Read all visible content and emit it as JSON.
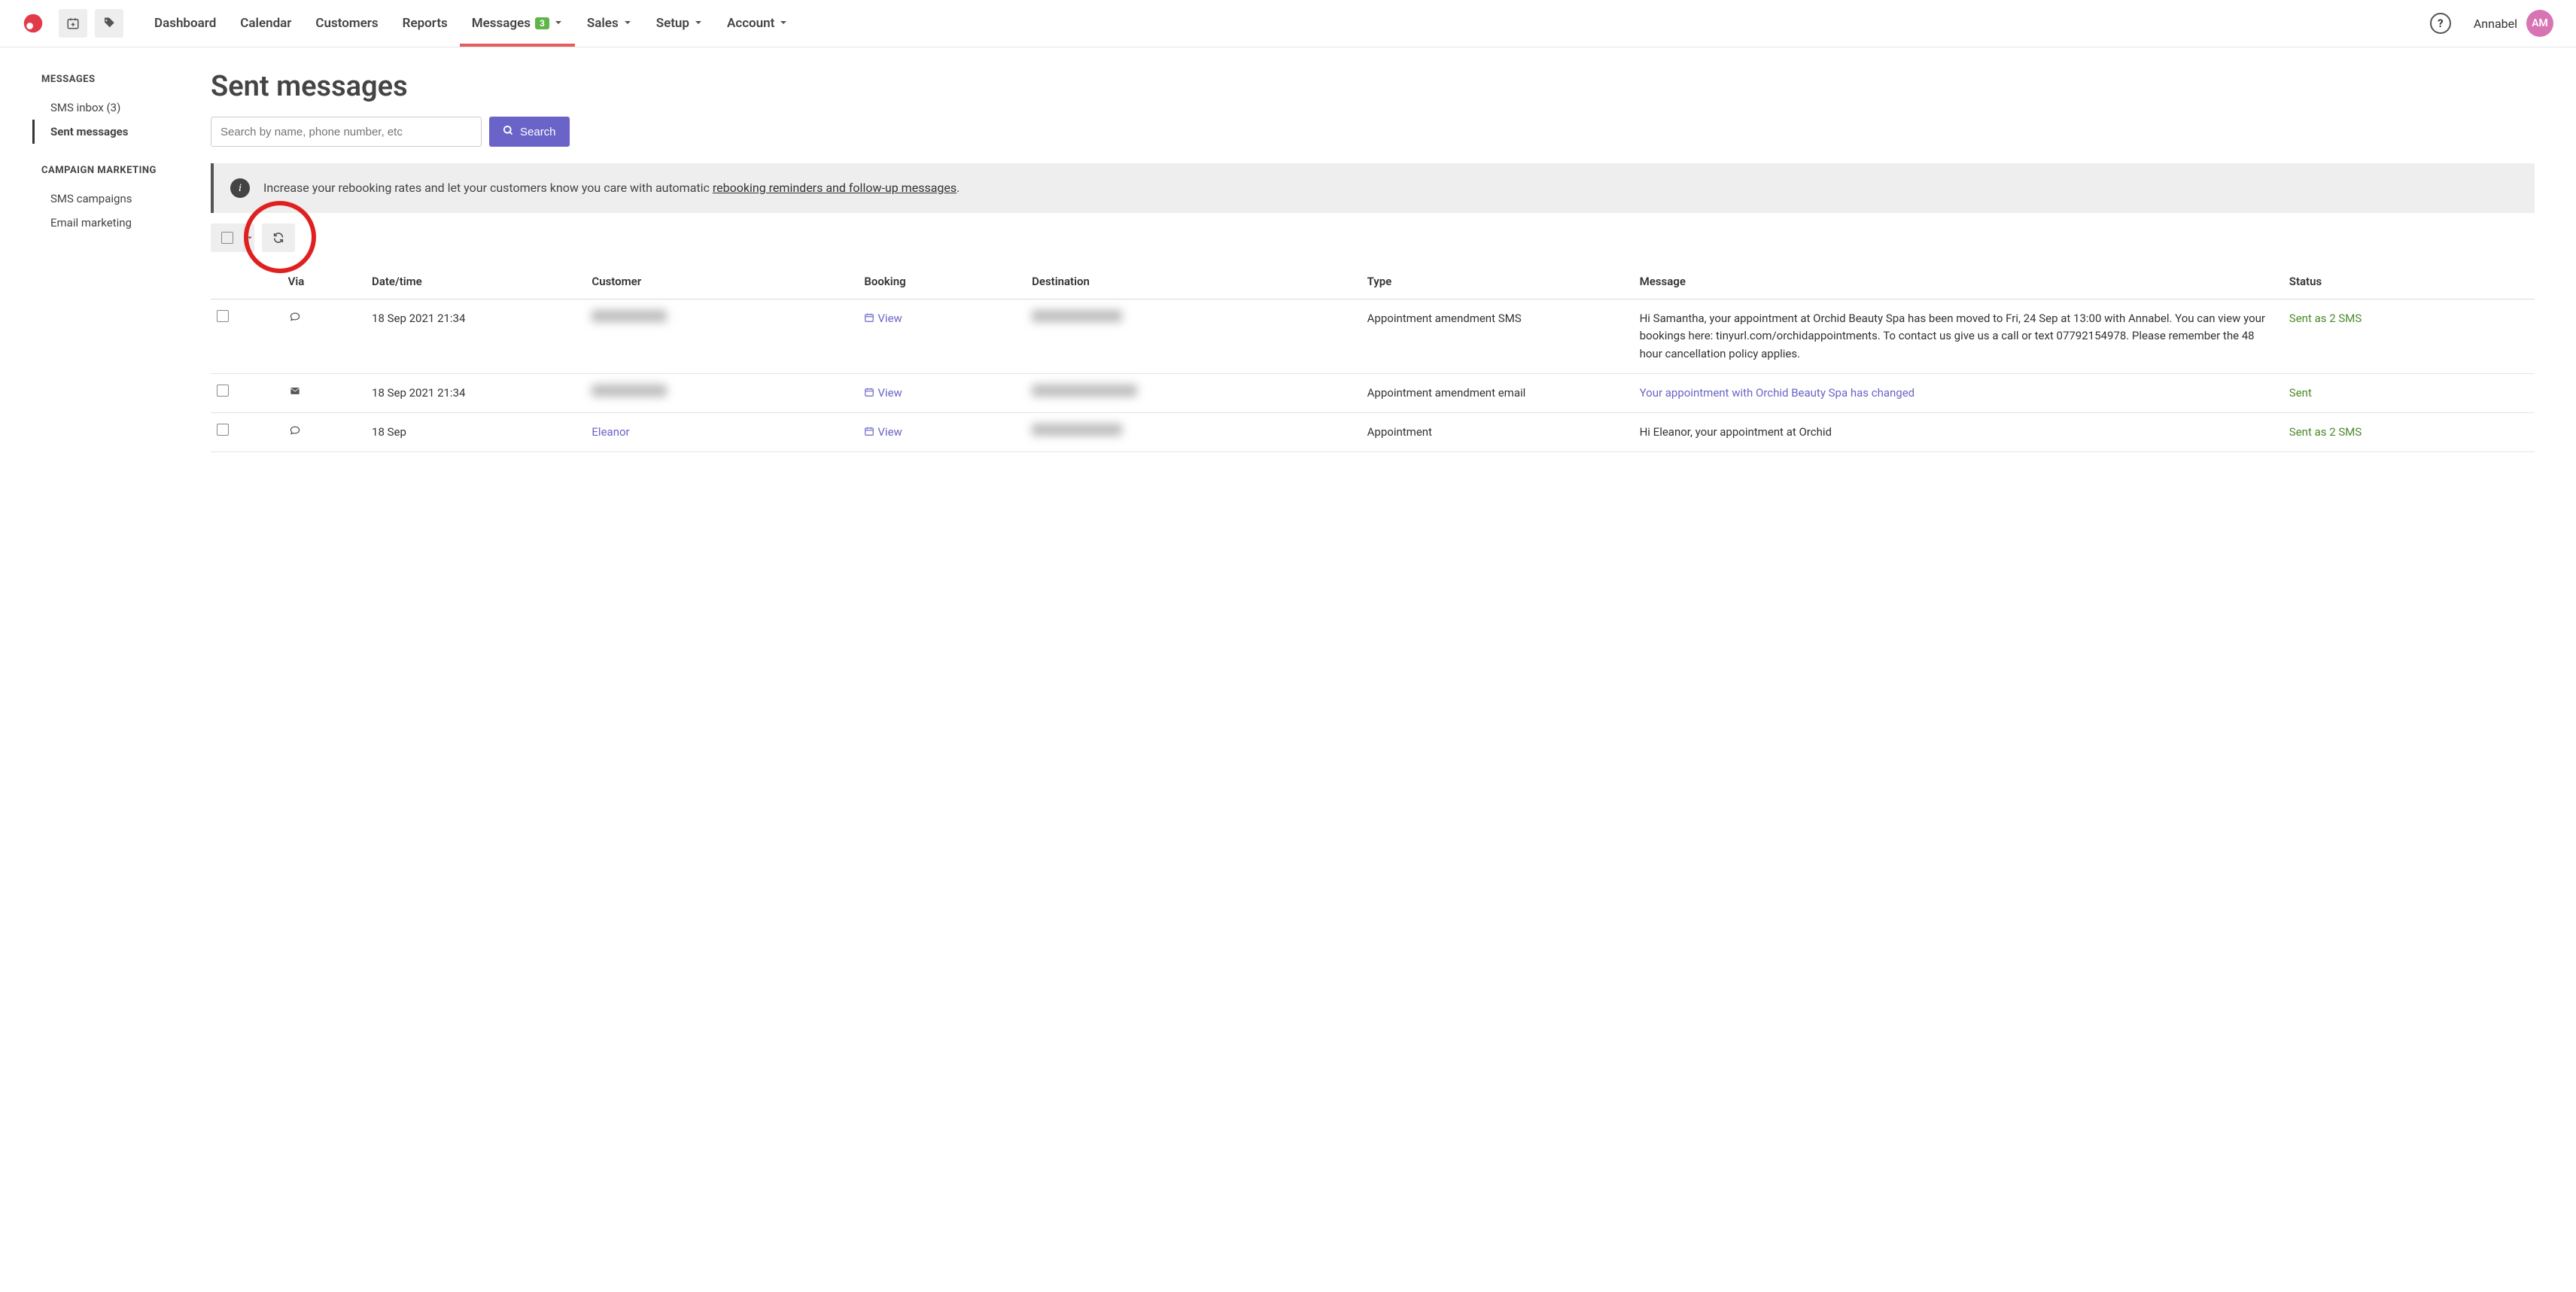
{
  "nav": {
    "items": [
      "Dashboard",
      "Calendar",
      "Customers",
      "Reports",
      "Messages",
      "Sales",
      "Setup",
      "Account"
    ],
    "messages_badge": "3",
    "username": "Annabel",
    "avatar_initials": "AM"
  },
  "sidebar": {
    "head1": "MESSAGES",
    "head2": "CAMPAIGN MARKETING",
    "items1": [
      "SMS inbox (3)",
      "Sent messages"
    ],
    "items2": [
      "SMS campaigns",
      "Email marketing"
    ]
  },
  "page": {
    "title": "Sent messages",
    "search_placeholder": "Search by name, phone number, etc",
    "search_button": "Search",
    "banner_lead": "Increase your rebooking rates and let your customers know you care with automatic ",
    "banner_link": "rebooking reminders and follow-up messages",
    "banner_tail": "."
  },
  "table": {
    "headers": [
      "Via",
      "Date/time",
      "Customer",
      "Booking",
      "Destination",
      "Type",
      "Message",
      "Status"
    ]
  },
  "rows": [
    {
      "via": "sms",
      "datetime": "18 Sep 2021 21:34",
      "customer_hidden": true,
      "view": "View",
      "dest_hidden": true,
      "type": "Appointment amendment SMS",
      "message": "Hi Samantha, your appointment at Orchid Beauty Spa has been moved to Fri, 24 Sep at 13:00 with Annabel. You can view your bookings here: tinyurl.com/orchidappointments. To contact us give us a call or text 07792154978. Please remember the 48 hour cancellation policy applies.",
      "message_is_link": false,
      "status": "Sent as 2 SMS"
    },
    {
      "via": "email",
      "datetime": "18 Sep 2021 21:34",
      "customer_hidden": true,
      "view": "View",
      "dest_hidden": true,
      "type": "Appointment amendment email",
      "message": "Your appointment with Orchid Beauty Spa has changed",
      "message_is_link": true,
      "status": "Sent"
    },
    {
      "via": "sms",
      "datetime": "18 Sep",
      "customer": "Eleanor",
      "customer_hidden": false,
      "view": "View",
      "dest_hidden": true,
      "type": "Appointment",
      "message": "Hi Eleanor, your appointment at Orchid",
      "message_is_link": false,
      "status": "Sent as 2 SMS"
    }
  ]
}
